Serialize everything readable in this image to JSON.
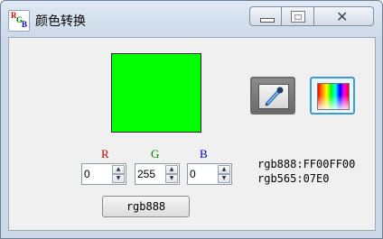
{
  "window": {
    "title": "颜色转换",
    "icon_letters": {
      "r": "R",
      "g": "G",
      "b": "B"
    },
    "controls": {
      "minimize": "minimize-icon",
      "maximize": "maximize-icon",
      "close": "close-icon"
    }
  },
  "color": {
    "preview_hex": "#00ff00"
  },
  "tools": {
    "eyedropper": "eyedropper-icon",
    "palette": "color-palette-icon"
  },
  "channels": [
    {
      "label": "R",
      "value": "0",
      "label_color": "#c00000"
    },
    {
      "label": "G",
      "value": "255",
      "label_color": "#008000"
    },
    {
      "label": "B",
      "value": "0",
      "label_color": "#0000c0"
    }
  ],
  "readout": {
    "rgb888": "rgb888:FF00FF00",
    "rgb565": "rgb565:07E0"
  },
  "mode_button": {
    "label": "rgb888"
  }
}
